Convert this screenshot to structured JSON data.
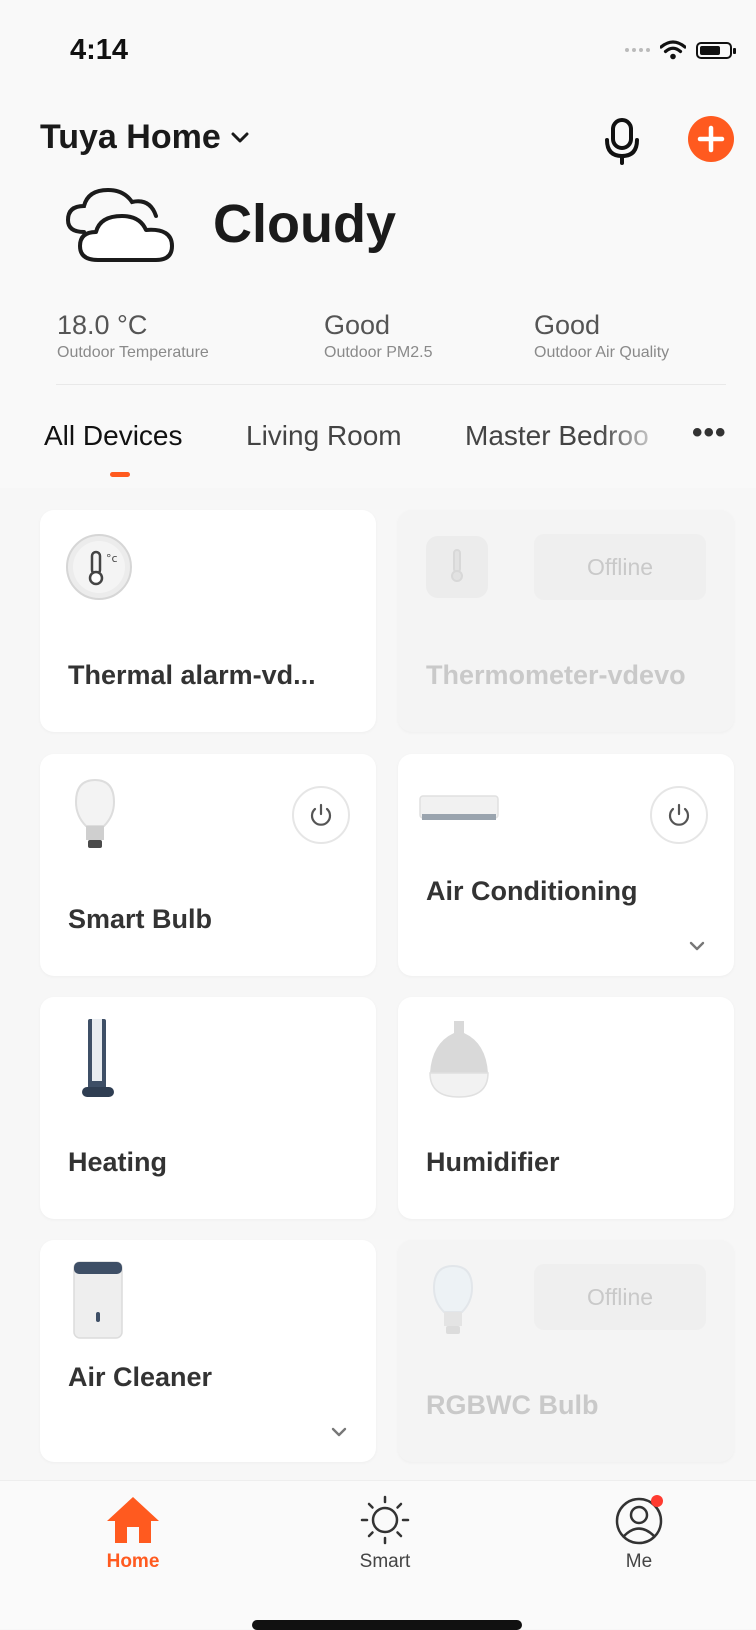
{
  "status_bar": {
    "time": "4:14"
  },
  "header": {
    "home_name": "Tuya Home"
  },
  "weather": {
    "condition": "Cloudy",
    "stats": [
      {
        "value": "18.0 °C",
        "label": "Outdoor Temperature"
      },
      {
        "value": "Good",
        "label": "Outdoor PM2.5"
      },
      {
        "value": "Good",
        "label": "Outdoor Air Quality"
      }
    ]
  },
  "tabs": [
    "All Devices",
    "Living Room",
    "Master Bedroo"
  ],
  "devices": [
    {
      "name": "Thermal alarm-vd...",
      "status": "online",
      "icon": "thermal-alarm-icon"
    },
    {
      "name": "Thermometer-vdevo",
      "status": "Offline",
      "icon": "thermometer-icon"
    },
    {
      "name": "Smart Bulb",
      "status": "online",
      "icon": "bulb-icon"
    },
    {
      "name": "Air Conditioning",
      "status": "online",
      "icon": "air-conditioner-icon"
    },
    {
      "name": "Heating",
      "status": "online",
      "icon": "heater-icon"
    },
    {
      "name": "Humidifier",
      "status": "online",
      "icon": "humidifier-icon"
    },
    {
      "name": "Air Cleaner",
      "status": "online",
      "icon": "air-cleaner-icon"
    },
    {
      "name": "RGBWC Bulb",
      "status": "Offline",
      "icon": "bulb-icon"
    }
  ],
  "tabbar": [
    {
      "label": "Home",
      "active": true
    },
    {
      "label": "Smart",
      "active": false
    },
    {
      "label": "Me",
      "active": false
    }
  ],
  "colors": {
    "accent": "#ff5a1f",
    "background": "#f7f7f7",
    "card": "#ffffff"
  }
}
